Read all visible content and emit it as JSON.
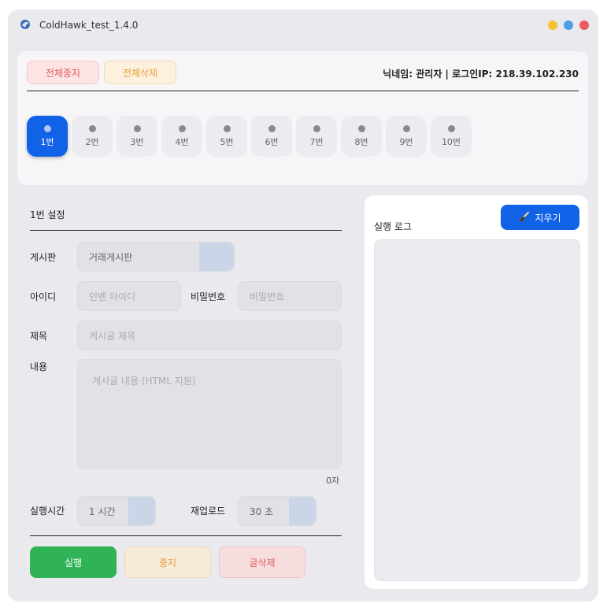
{
  "window": {
    "title": "ColdHawk_test_1.4.0"
  },
  "toolbar": {
    "stop_all_label": "전체중지",
    "delete_all_label": "전체삭제",
    "user_info": "닉네임: 관리자  |  로그인IP: 218.39.102.230"
  },
  "slots": [
    "1번",
    "2번",
    "3번",
    "4번",
    "5번",
    "6번",
    "7번",
    "8번",
    "9번",
    "10번"
  ],
  "active_slot": 0,
  "settings": {
    "title": "1번 설정",
    "board_label": "게시판",
    "board_value": "거래게시판",
    "id_label": "아이디",
    "id_placeholder": "인벤 아이디",
    "pw_label": "비밀번호",
    "pw_placeholder": "비밀번호",
    "subject_label": "제목",
    "subject_placeholder": "게시글 제목",
    "content_label": "내용",
    "content_placeholder": "게시글 내용 (HTML 지원)",
    "char_count": "0자",
    "run_time_label": "실행시간",
    "run_time_value": "1 시간",
    "reload_label": "재업로드",
    "reload_value": "30 초"
  },
  "actions": {
    "run_label": "실행",
    "stop_label": "중지",
    "delete_label": "글삭제"
  },
  "log": {
    "title": "실행 로그",
    "clear_label": "지우기"
  },
  "colors": {
    "accent": "#1262e8",
    "run": "#2fb356",
    "stop": "#e3a03a",
    "danger": "#e25c5c"
  }
}
